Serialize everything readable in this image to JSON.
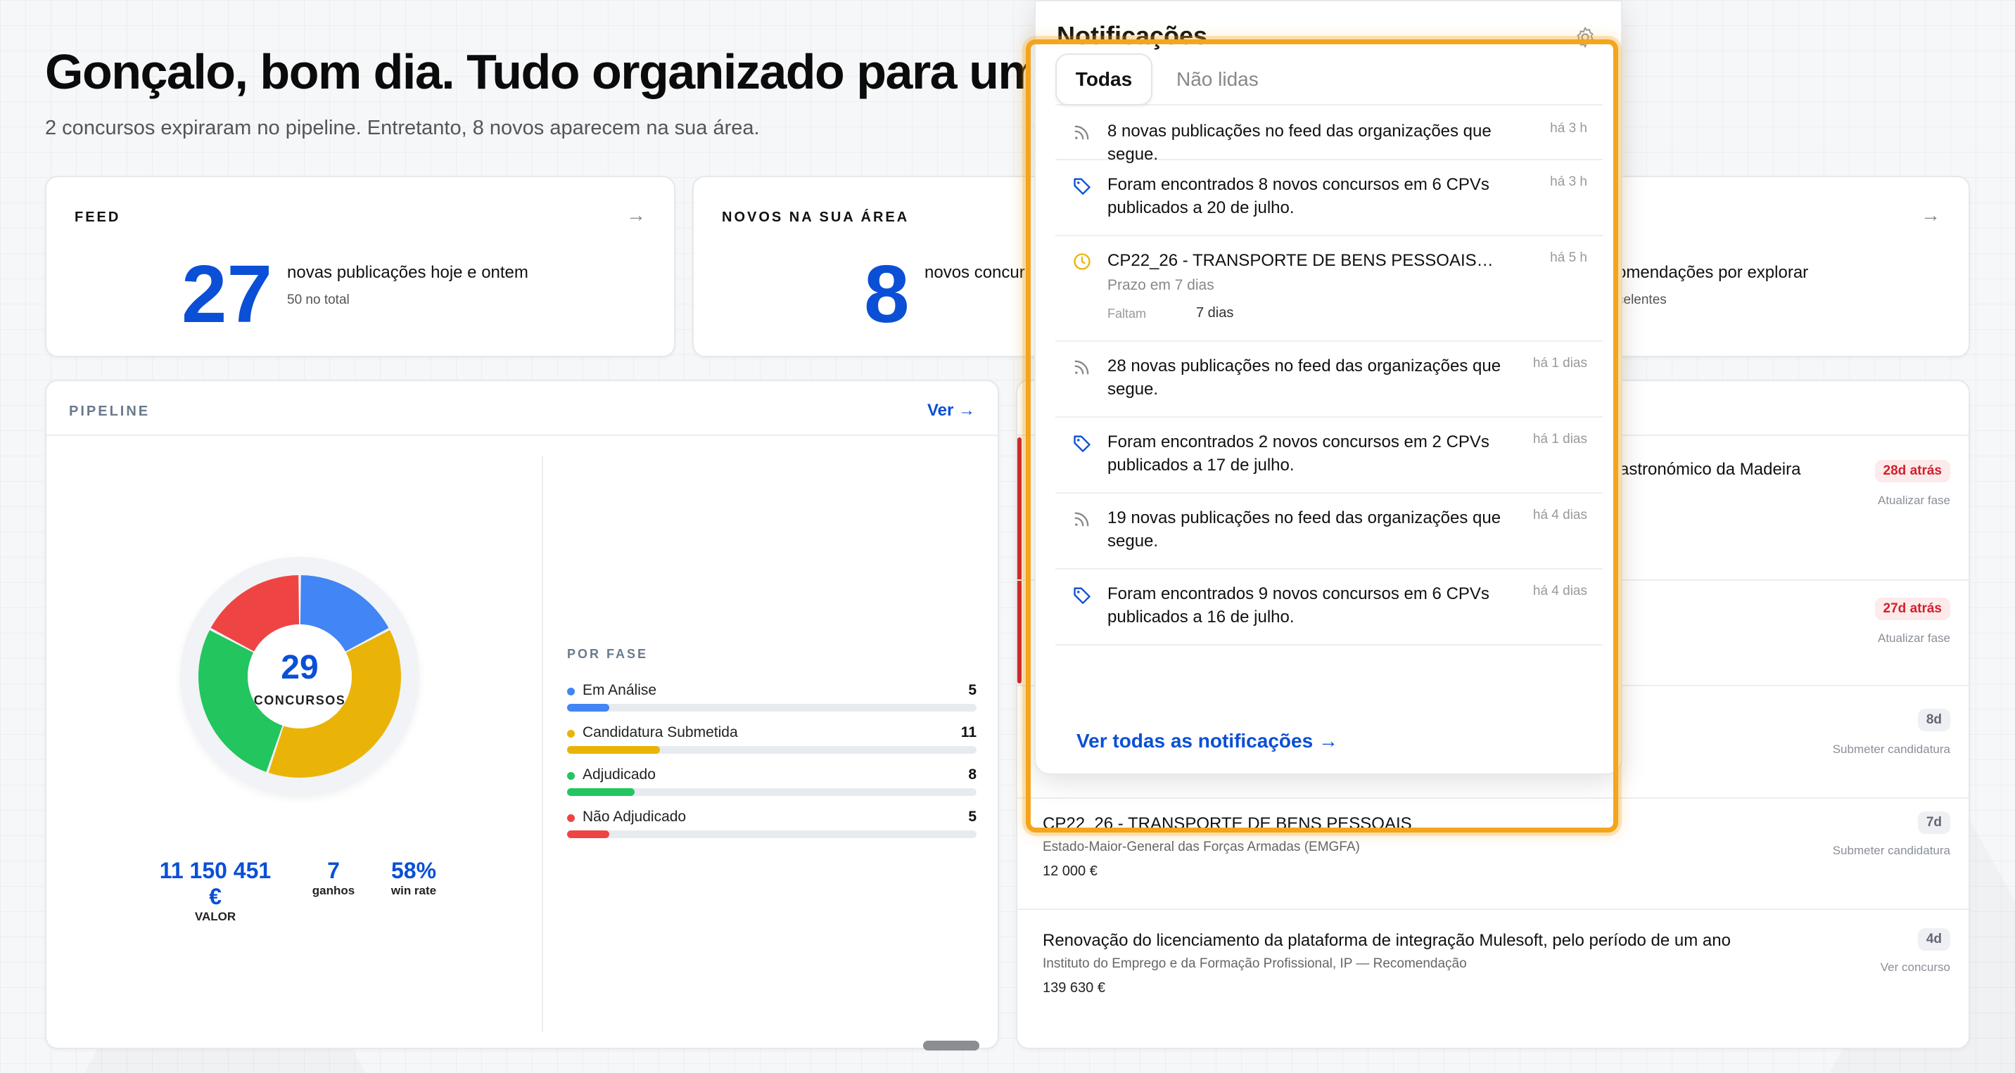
{
  "greeting": "Gonçalo, bom dia. Tudo organizado para uma m",
  "subtitle": "2 concursos expiraram no pipeline. Entretanto, 8 novos aparecem na sua área.",
  "cards": {
    "feed": {
      "label": "FEED",
      "number": "27",
      "desc": "novas publicações hoje e ontem",
      "sub": "50 no total",
      "arrow": "→"
    },
    "novos": {
      "label": "NOVOS NA SUA ÁREA",
      "number": "8",
      "desc": "novos concur"
    },
    "recs": {
      "desc": "omendações por explorar",
      "sub": "celentes",
      "arrow": "→"
    }
  },
  "pipeline": {
    "label": "PIPELINE",
    "link": "Ver →",
    "donut_number": "29",
    "donut_label": "CONCURSOS",
    "por_fase_label": "POR FASE",
    "phases": [
      {
        "name": "Em Análise",
        "value": "5",
        "fraction": 0.1724,
        "color": "#4285f4"
      },
      {
        "name": "Candidatura Submetida",
        "value": "11",
        "fraction": 0.3793,
        "color": "#eab308"
      },
      {
        "name": "Adjudicado",
        "value": "8",
        "fraction": 0.2759,
        "color": "#22c55e"
      },
      {
        "name": "Não Adjudicado",
        "value": "5",
        "fraction": 0.1724,
        "color": "#ef4444"
      }
    ],
    "metrics": [
      {
        "value": "11 150 451 €",
        "label": "VALOR"
      },
      {
        "value": "7",
        "label": "ganhos"
      },
      {
        "value": "58%",
        "label": "win rate"
      }
    ]
  },
  "recommendations": [
    {
      "title": "astronómico da Madeira",
      "org": "",
      "price": "",
      "badge": "28d atrás",
      "badge_type": "red",
      "action": "Atualizar fase"
    },
    {
      "title": "",
      "org": "",
      "price": "",
      "badge": "27d atrás",
      "badge_type": "red",
      "action": "Atualizar fase"
    },
    {
      "title": "",
      "org": "",
      "price": "",
      "badge": "8d",
      "badge_type": "grey",
      "action": "Submeter candidatura"
    },
    {
      "title": "CP22_26 - TRANSPORTE DE BENS PESSOAIS",
      "org": "Estado-Maior-General das Forças Armadas (EMGFA)",
      "price": "12 000 €",
      "badge": "7d",
      "badge_type": "grey",
      "action": "Submeter candidatura"
    },
    {
      "title": "Renovação do licenciamento da plataforma de integração Mulesoft, pelo período de um ano",
      "org": "Instituto do Emprego e da Formação Profissional, IP — Recomendação",
      "price": "139 630 €",
      "badge": "4d",
      "badge_type": "grey",
      "action": "Ver concurso"
    }
  ],
  "notifications": {
    "title": "Notificações",
    "tabs": [
      "Todas",
      "Não lidas"
    ],
    "items": [
      {
        "icon": "rss-icon",
        "text": "8 novas publicações no feed das organizações que segue.",
        "time": "há 3 h"
      },
      {
        "icon": "tag-icon",
        "text": "Foram encontrados 8 novos concursos em 6 CPVs publicados a 20 de julho.",
        "time": "há 3 h"
      },
      {
        "icon": "clock-icon",
        "text": "CP22_26 - TRANSPORTE DE BENS PESSOAIS…",
        "sub": "Prazo em 7 dias",
        "meta_label": "Faltam",
        "meta_value": "7 dias",
        "time": "há 5 h"
      },
      {
        "icon": "rss-icon",
        "text": "28 novas publicações no feed das organizações que segue.",
        "time": "há 1 dias"
      },
      {
        "icon": "tag-icon",
        "text": "Foram encontrados 2 novos concursos em 2 CPVs publicados a 17 de julho.",
        "time": "há 1 dias"
      },
      {
        "icon": "rss-icon",
        "text": "19 novas publicações no feed das organizações que segue.",
        "time": "há 4 dias"
      },
      {
        "icon": "tag-icon",
        "text": "Foram encontrados 9 novos concursos em 6 CPVs publicados a 16 de julho.",
        "time": "há 4 dias"
      }
    ],
    "see_all": "Ver todas as notificações →"
  },
  "colors": {
    "accent": "#0a4fd6",
    "highlight": "#f4a51c"
  }
}
